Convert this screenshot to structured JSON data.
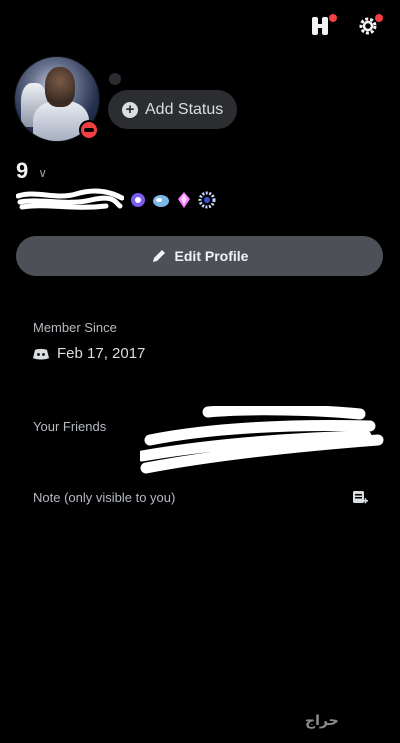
{
  "header": {
    "icons": [
      "nitro-icon",
      "settings-icon"
    ]
  },
  "profile": {
    "status_button_label": "Add Status",
    "display_name": "9",
    "status": "do-not-disturb",
    "edit_button_label": "Edit Profile"
  },
  "member_since": {
    "label": "Member Since",
    "date": "Feb 17, 2017"
  },
  "friends": {
    "label": "Your Friends"
  },
  "note": {
    "label": "Note (only visible to you)"
  },
  "watermark": {
    "text": "حراج"
  },
  "colors": {
    "accent_red": "#f23f43",
    "button_gray": "#4e5058",
    "pill_bg": "#2b2d31"
  }
}
